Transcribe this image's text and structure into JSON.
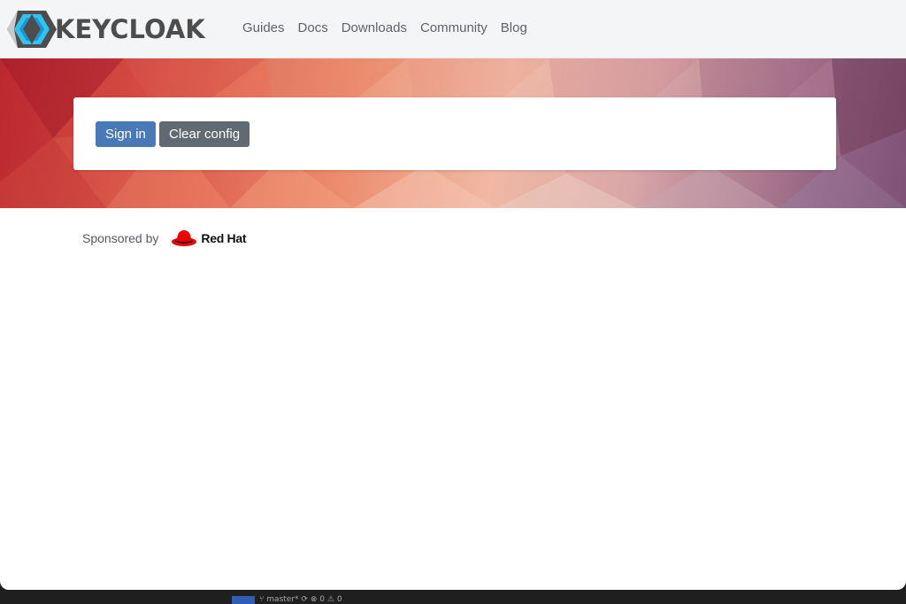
{
  "brand": {
    "name": "KEYCLOAK",
    "logo_icon": "keycloak-hexagon-icon"
  },
  "nav": {
    "items": [
      {
        "label": "Guides"
      },
      {
        "label": "Docs"
      },
      {
        "label": "Downloads"
      },
      {
        "label": "Community"
      },
      {
        "label": "Blog"
      }
    ]
  },
  "card": {
    "sign_in_label": "Sign in",
    "clear_config_label": "Clear config"
  },
  "sponsor": {
    "label": "Sponsored by",
    "company": "Red Hat",
    "company_icon": "redhat-fedora-icon"
  },
  "statusbar": {
    "branch": "master*",
    "errors": "0",
    "warnings": "0"
  },
  "colors": {
    "primary_button": "#4a79b8",
    "secondary_button": "#606a72",
    "navbar_bg": "#f4f5f7",
    "redhat_red": "#ee0000"
  }
}
